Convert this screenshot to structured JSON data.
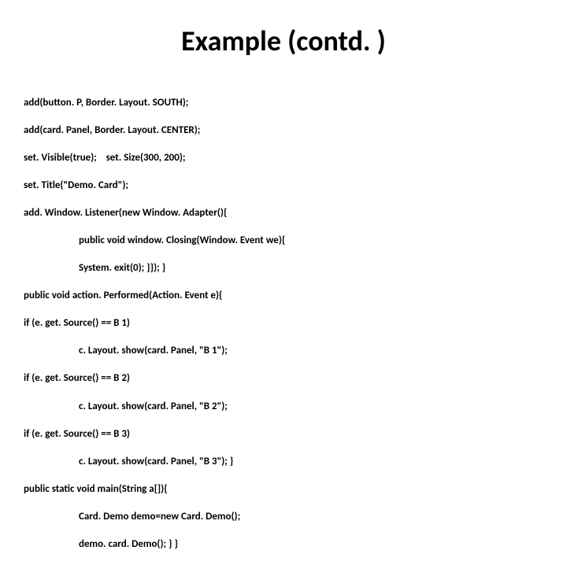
{
  "title": "Example (contd. )",
  "code": {
    "line1": "add(button. P, Border. Layout. SOUTH);",
    "line2": "add(card. Panel, Border. Layout. CENTER);",
    "line3": "set. Visible(true);    set. Size(300, 200);",
    "line4": "set. Title(\"Demo. Card\");",
    "line5": "add. Window. Listener(new Window. Adapter(){",
    "line6": "public void window. Closing(Window. Event we){",
    "line7": "System. exit(0); }}); }",
    "line8": "public void action. Performed(Action. Event e){",
    "line9": "if (e. get. Source() == B 1)",
    "line10": "c. Layout. show(card. Panel, \"B 1\");",
    "line11": "if (e. get. Source() == B 2)",
    "line12": "c. Layout. show(card. Panel, \"B 2\");",
    "line13": "if (e. get. Source() == B 3)",
    "line14": "c. Layout. show(card. Panel, \"B 3\"); }",
    "line15": "public static void main(String a[]){",
    "line16": "Card. Demo demo=new Card. Demo();",
    "line17": "demo. card. Demo(); } }"
  }
}
